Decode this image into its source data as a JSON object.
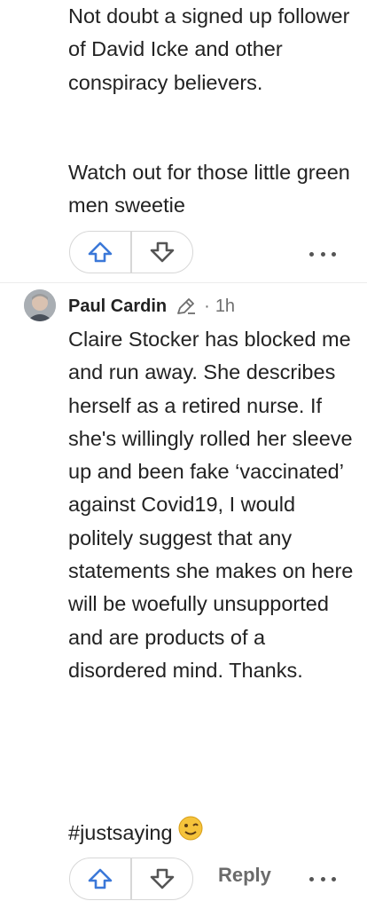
{
  "comment_top": {
    "paragraph1": "Not doubt a signed up follower of David Icke and other conspiracy believers.",
    "paragraph2": "Watch out for those little green men sweetie"
  },
  "comment_main": {
    "author": "Paul Cardin",
    "separator": "·",
    "time": "1h",
    "paragraph1": "Claire Stocker has blocked me and run away. She describes herself as a retired nurse. If she's willingly rolled her sleeve up and been fake ‘vaccinated’ against Covid19, I would politely suggest that any statements she makes on here will be woefully unsupported and are products of a disordered mind. Thanks.",
    "hashtag": "#justsaying",
    "reply_label": "Reply"
  },
  "icons": {
    "upvote": "arrow-up-outline-icon",
    "downvote": "arrow-down-outline-icon",
    "more": "more-dots-icon",
    "pen": "pencil-icon",
    "emoji": "winking-face-emoji"
  },
  "colors": {
    "upvote": "#3b78d8",
    "downvote": "#555555",
    "text": "#222222",
    "muted": "#6e6e6e"
  }
}
